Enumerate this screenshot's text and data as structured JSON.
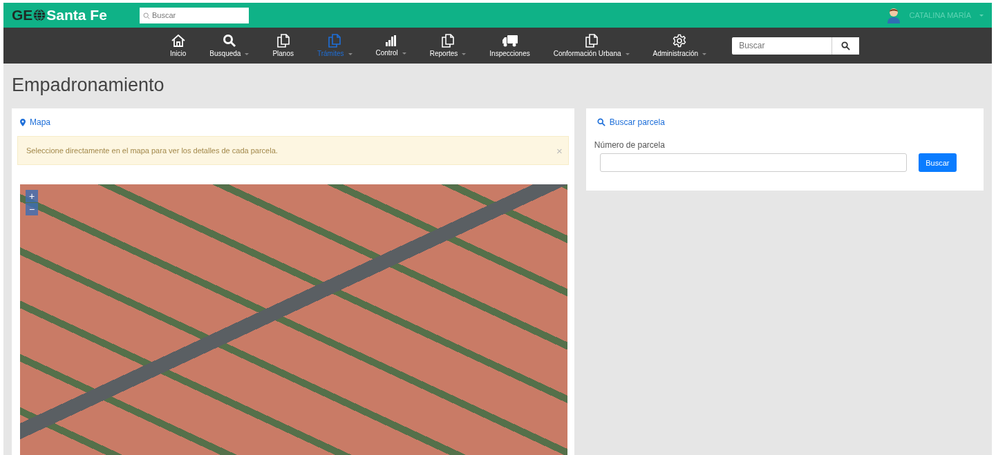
{
  "header": {
    "logo_prefix": "GE",
    "logo_suffix": "Santa Fe",
    "search": {
      "placeholder": "Buscar"
    },
    "user": {
      "name": "CATALINA MARÍA",
      "dropdown": true
    }
  },
  "nav": {
    "items": [
      {
        "kind": "home",
        "label": "Inicio",
        "dropdown": false,
        "selected": false
      },
      {
        "kind": "search",
        "label": "Busqueda",
        "dropdown": true,
        "selected": false
      },
      {
        "kind": "document",
        "label": "Planos",
        "dropdown": false,
        "selected": false
      },
      {
        "kind": "document",
        "label": "Trámites",
        "dropdown": true,
        "selected": true
      },
      {
        "kind": "chart",
        "label": "Control",
        "dropdown": true,
        "selected": false
      },
      {
        "kind": "document",
        "label": "Reportes",
        "dropdown": true,
        "selected": false
      },
      {
        "kind": "vehicle",
        "label": "Inspecciones",
        "dropdown": false,
        "selected": false
      },
      {
        "kind": "document",
        "label": "Conformación Urbana",
        "dropdown": true,
        "selected": false
      },
      {
        "kind": "settings",
        "label": "Administración",
        "dropdown": true,
        "selected": false
      }
    ],
    "search": {
      "placeholder": "Buscar"
    }
  },
  "page_title": "Empadronamiento",
  "map_panel": {
    "title": "Mapa",
    "alert": {
      "text": "Seleccione directamente en el mapa para ver los detalles de cada parcela.",
      "dismissible": true,
      "close_label": "×"
    },
    "zoom_in": "+",
    "zoom_out": "−"
  },
  "search_panel": {
    "title": "Buscar parcela",
    "field_label": "Número de parcela",
    "button": "Buscar"
  }
}
